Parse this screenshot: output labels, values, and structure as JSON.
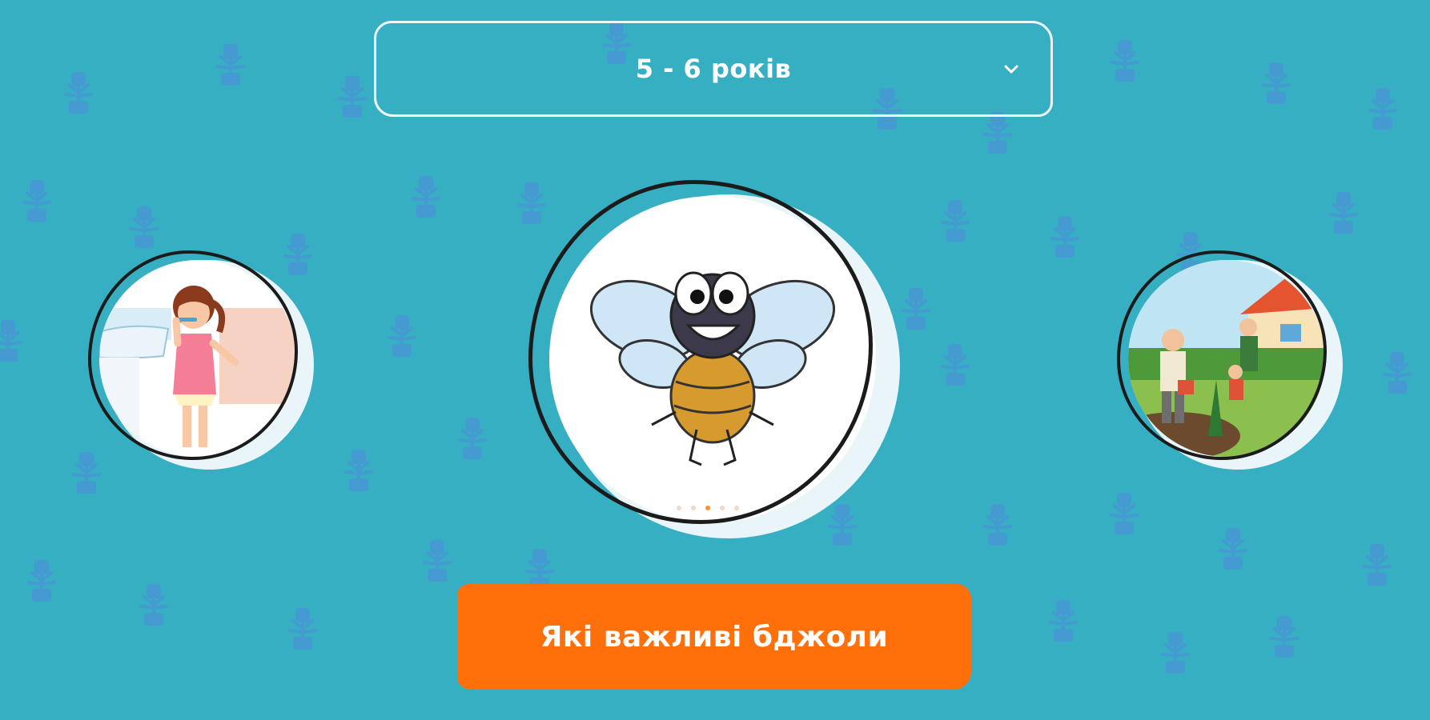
{
  "age_selector": {
    "value": "5 - 6 років",
    "icon": "chevron-down-icon"
  },
  "carousel": {
    "slides": [
      {
        "name": "girl-brushing-teeth"
      },
      {
        "name": "bee"
      },
      {
        "name": "gardening-family"
      }
    ],
    "active_index": 1,
    "dot_count": 5,
    "active_dot_index": 2
  },
  "cta": {
    "label": "Які важливі бджоли"
  },
  "colors": {
    "background": "#37AFC3",
    "pattern": "#4A93D6",
    "accent": "#FF6F0A",
    "outline": "#1B1B1B"
  }
}
